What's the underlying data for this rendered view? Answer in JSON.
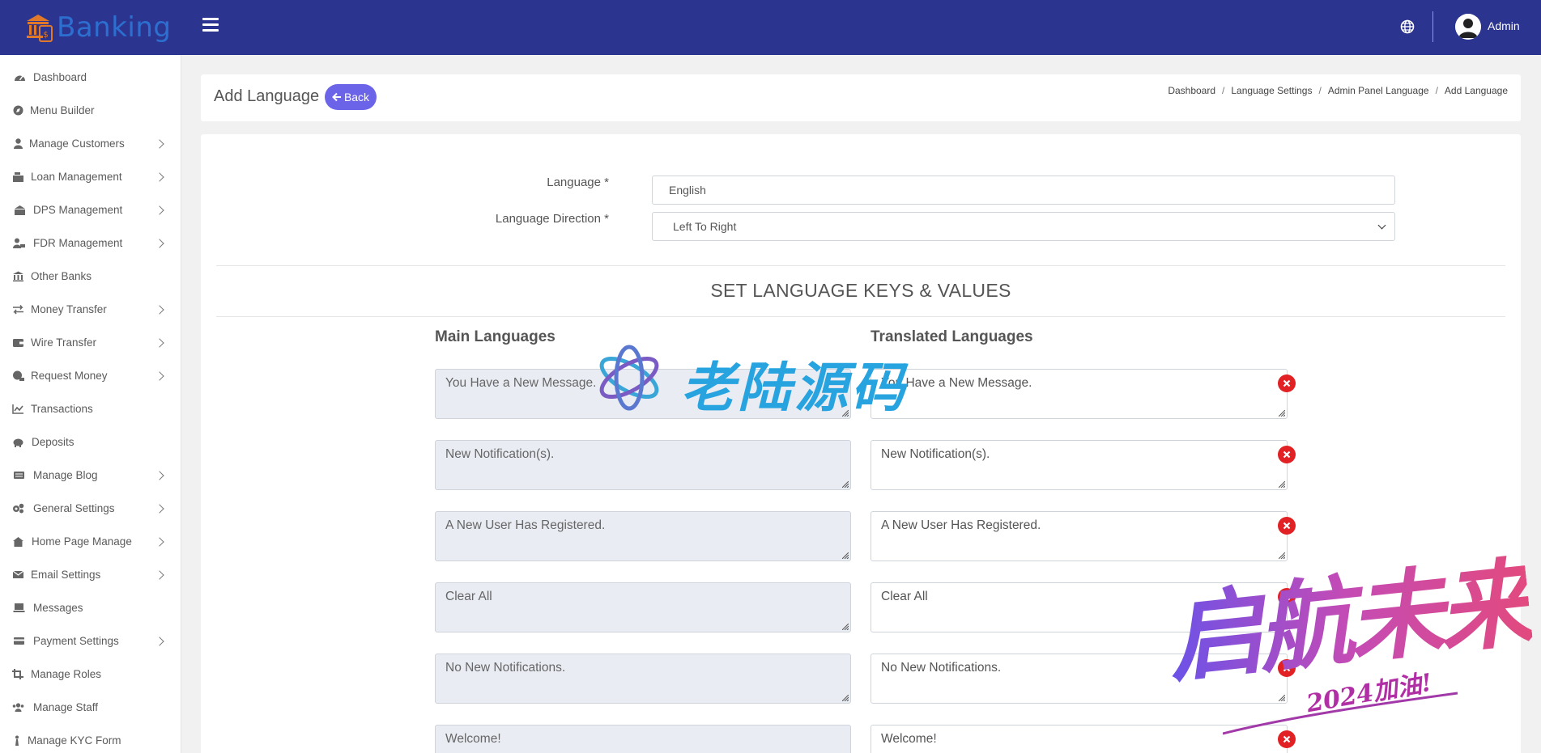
{
  "header": {
    "brand_text": "Banking",
    "admin_name": "Admin"
  },
  "sidebar": {
    "items": [
      {
        "label": "Dashboard",
        "icon": "dashboard-icon",
        "has_submenu": false
      },
      {
        "label": "Menu Builder",
        "icon": "compass-icon",
        "has_submenu": false
      },
      {
        "label": "Manage Customers",
        "icon": "user-icon",
        "has_submenu": true
      },
      {
        "label": "Loan Management",
        "icon": "cash-register-icon",
        "has_submenu": true
      },
      {
        "label": "DPS Management",
        "icon": "building-icon",
        "has_submenu": true
      },
      {
        "label": "FDR Management",
        "icon": "user-money-icon",
        "has_submenu": true
      },
      {
        "label": "Other Banks",
        "icon": "bank-icon",
        "has_submenu": false
      },
      {
        "label": "Money Transfer",
        "icon": "exchange-icon",
        "has_submenu": true
      },
      {
        "label": "Wire Transfer",
        "icon": "wallet-icon",
        "has_submenu": true
      },
      {
        "label": "Request Money",
        "icon": "money-request-icon",
        "has_submenu": true
      },
      {
        "label": "Transactions",
        "icon": "chart-line-icon",
        "has_submenu": false
      },
      {
        "label": "Deposits",
        "icon": "piggy-bank-icon",
        "has_submenu": false
      },
      {
        "label": "Manage Blog",
        "icon": "blog-icon",
        "has_submenu": true
      },
      {
        "label": "General Settings",
        "icon": "cogs-icon",
        "has_submenu": true
      },
      {
        "label": "Home Page Manage",
        "icon": "home-page-icon",
        "has_submenu": true
      },
      {
        "label": "Email Settings",
        "icon": "envelope-icon",
        "has_submenu": true
      },
      {
        "label": "Messages",
        "icon": "messages-icon",
        "has_submenu": false
      },
      {
        "label": "Payment Settings",
        "icon": "credit-card-icon",
        "has_submenu": true
      },
      {
        "label": "Manage Roles",
        "icon": "crop-icon",
        "has_submenu": false
      },
      {
        "label": "Manage Staff",
        "icon": "users-icon",
        "has_submenu": false
      },
      {
        "label": "Manage KYC Form",
        "icon": "kyc-icon",
        "has_submenu": false
      }
    ]
  },
  "page": {
    "title": "Add Language",
    "back_label": "Back",
    "breadcrumb": [
      "Dashboard",
      "Language Settings",
      "Admin Panel Language",
      "Add Language"
    ]
  },
  "form": {
    "language_label": "Language *",
    "language_value": "English",
    "direction_label": "Language Direction *",
    "direction_value": "Left To Right",
    "section_title": "SET LANGUAGE KEYS & VALUES",
    "main_col_head": "Main Languages",
    "translated_col_head": "Translated Languages",
    "pairs": [
      {
        "key": "You Have a New Message.",
        "value": "You Have a New Message."
      },
      {
        "key": "New Notification(s).",
        "value": "New Notification(s)."
      },
      {
        "key": "A New User Has Registered.",
        "value": "A New User Has Registered."
      },
      {
        "key": "Clear All",
        "value": "Clear All"
      },
      {
        "key": "No New Notifications.",
        "value": "No New Notifications."
      },
      {
        "key": "Welcome!",
        "value": "Welcome!"
      }
    ]
  },
  "watermarks": {
    "center_text": "老陆源码",
    "corner_text": "启航未来",
    "corner_subtext": "2024加油!"
  },
  "colors": {
    "topbar": "#2b358f",
    "back_button": "#6c64e8",
    "remove_button": "#e22124",
    "key_textarea_bg": "#e9ecf3"
  }
}
